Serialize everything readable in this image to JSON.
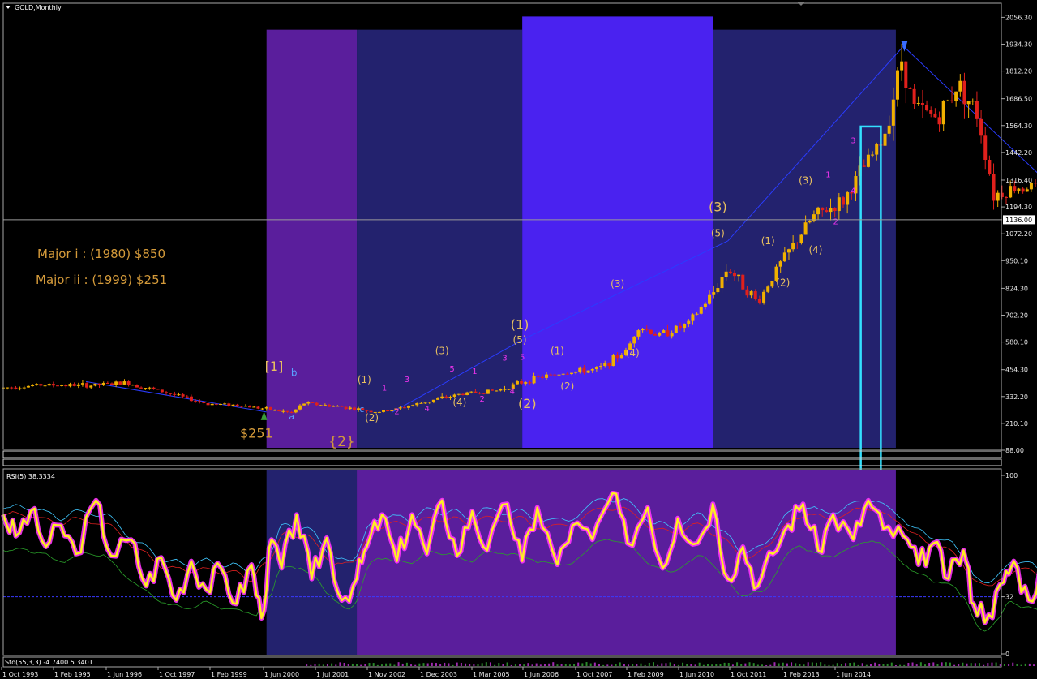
{
  "header": {
    "symbol": "GOLD,Monthly",
    "rsi_label": "RSI(5) 38.3334",
    "sto_label": "Sto(55,3,3) -4.7400 5.3401"
  },
  "notes": {
    "major_i": "Major i : (1980) $850",
    "major_ii": "Major ii : (1999) $251"
  },
  "colors": {
    "background": "#000000",
    "bull_candle": "#f0b000",
    "bear_candle": "#e0201c",
    "shade_violet": "#5a1e9c",
    "shade_navy": "#23226e",
    "shade_blue": "#4a22f0",
    "rsi_main": "#ffee22",
    "rsi_glow": "#ff33ff",
    "box_cyan": "#33e0ff",
    "wave_yellow": "#e8c060",
    "wave_magenta": "#ee33ee",
    "wave_cyan": "#5aa0ff"
  },
  "chart_data": {
    "type": "line",
    "subtype": "candlestick-with-rsi-panel",
    "title": "GOLD,Monthly",
    "price_axis": {
      "ticks": [
        2056.3,
        1934.3,
        1812.2,
        1686.5,
        1564.3,
        1442.2,
        1316.4,
        1194.3,
        1072.2,
        950.1,
        824.3,
        702.2,
        580.1,
        454.3,
        332.2,
        210.1,
        88.0
      ],
      "tick_labels": [
        "2056.30",
        "1934.30",
        "1812.20",
        "1686.50",
        "1564.30",
        "1442.20",
        "1316.40",
        "1194.30",
        "1072.20",
        "950.10",
        "824.30",
        "702.20",
        "580.10",
        "454.30",
        "332.20",
        "210.10",
        "88.00"
      ],
      "current_price": 1136.0,
      "current_label": "1136.00"
    },
    "rsi_axis": {
      "ticks": [
        100,
        32,
        0
      ],
      "tick_labels": [
        "100",
        "32",
        "0"
      ],
      "level_line": 32
    },
    "time_axis": {
      "tick_labels": [
        "1 Oct 1993",
        "1 Feb 1995",
        "1 Jun 1996",
        "1 Oct 1997",
        "1 Feb 1999",
        "1 Jun 2000",
        "1 Jul 2001",
        "1 Nov 2002",
        "1 Dec 2003",
        "1 Mar 2005",
        "1 Jun 2006",
        "1 Oct 2007",
        "1 Feb 2009",
        "1 Jun 2010",
        "1 Oct 2011",
        "1 Feb 2013",
        "1 Jun 2014"
      ]
    },
    "price_path": [
      [
        1993.75,
        372
      ],
      [
        1994.5,
        385
      ],
      [
        1995.5,
        383
      ],
      [
        1996.2,
        395
      ],
      [
        1997.0,
        350
      ],
      [
        1997.8,
        300
      ],
      [
        1998.5,
        292
      ],
      [
        1999.5,
        258
      ],
      [
        1999.75,
        302
      ],
      [
        2000.5,
        285
      ],
      [
        2001.2,
        262
      ],
      [
        2001.5,
        270
      ],
      [
        2002.3,
        315
      ],
      [
        2002.9,
        345
      ],
      [
        2003.6,
        360
      ],
      [
        2004.3,
        412
      ],
      [
        2004.9,
        440
      ],
      [
        2005.6,
        455
      ],
      [
        2006.2,
        545
      ],
      [
        2006.4,
        655
      ],
      [
        2006.8,
        610
      ],
      [
        2007.4,
        660
      ],
      [
        2007.9,
        800
      ],
      [
        2008.2,
        920
      ],
      [
        2008.8,
        760
      ],
      [
        2009.2,
        920
      ],
      [
        2009.9,
        1150
      ],
      [
        2010.5,
        1220
      ],
      [
        2010.9,
        1370
      ],
      [
        2011.3,
        1500
      ],
      [
        2011.67,
        1870
      ],
      [
        2011.9,
        1650
      ],
      [
        2012.4,
        1600
      ],
      [
        2012.8,
        1760
      ],
      [
        2013.2,
        1600
      ],
      [
        2013.5,
        1250
      ],
      [
        2013.9,
        1280
      ],
      [
        2014.3,
        1290
      ],
      [
        2014.7,
        1220
      ],
      [
        2015.2,
        1185
      ],
      [
        2015.6,
        1100
      ]
    ],
    "wave_lines": [
      [
        [
          1995.4,
          400
        ],
        [
          1999.0,
          262
        ]
      ],
      [
        [
          2001.5,
          260
        ],
        [
          2004.1,
          590
        ]
      ],
      [
        [
          2004.1,
          590
        ],
        [
          2008.2,
          1040
        ]
      ],
      [
        [
          2008.2,
          1040
        ],
        [
          2011.7,
          1925
        ]
      ],
      [
        [
          2011.7,
          1925
        ],
        [
          2015.6,
          1085
        ]
      ]
    ],
    "shaded_regions": [
      {
        "from": 1999.0,
        "to": 2000.8,
        "color": "violet",
        "price_top": 2000
      },
      {
        "from": 2000.8,
        "to": 2004.1,
        "color": "navy",
        "price_top": 2000
      },
      {
        "from": 2004.1,
        "to": 2007.9,
        "color": "blue",
        "price_top": 2060
      },
      {
        "from": 2007.9,
        "to": 2011.55,
        "color": "navy",
        "price_top": 2000
      }
    ],
    "rsi_shaded_regions": [
      {
        "from": 1999.0,
        "to": 2000.8,
        "color": "navy"
      },
      {
        "from": 2000.8,
        "to": 2011.55,
        "color": "violet"
      }
    ],
    "highlight_box": {
      "from": 2010.85,
      "to": 2011.25,
      "price_top": 1560
    },
    "wave_labels": [
      {
        "t": "[1]",
        "x": 1999.15,
        "p": 450,
        "c": "yellow",
        "s": 16
      },
      {
        "t": "b",
        "x": 1999.55,
        "p": 425,
        "c": "cyan",
        "s": 12
      },
      {
        "t": "a",
        "x": 1999.5,
        "p": 228,
        "c": "cyan",
        "s": 11
      },
      {
        "t": "$251",
        "x": 1998.8,
        "p": 145,
        "c": "orange",
        "s": 16
      },
      {
        "t": "c",
        "x": 2000.9,
        "p": 262,
        "c": "cyan",
        "s": 11
      },
      {
        "t": "{2}",
        "x": 2000.5,
        "p": 107,
        "c": "orange",
        "s": 17
      },
      {
        "t": "(1)",
        "x": 2000.95,
        "p": 395,
        "c": "yellow",
        "s": 12
      },
      {
        "t": "1",
        "x": 2001.35,
        "p": 360,
        "c": "magenta",
        "s": 10
      },
      {
        "t": "3",
        "x": 2001.8,
        "p": 397,
        "c": "magenta",
        "s": 10
      },
      {
        "t": "2",
        "x": 2001.6,
        "p": 252,
        "c": "magenta",
        "s": 10
      },
      {
        "t": "(2)",
        "x": 2001.1,
        "p": 220,
        "c": "yellow",
        "s": 12
      },
      {
        "t": "4",
        "x": 2002.2,
        "p": 265,
        "c": "magenta",
        "s": 10
      },
      {
        "t": "(3)",
        "x": 2002.5,
        "p": 525,
        "c": "yellow",
        "s": 12
      },
      {
        "t": "5",
        "x": 2002.7,
        "p": 445,
        "c": "magenta",
        "s": 10
      },
      {
        "t": "1",
        "x": 2003.15,
        "p": 435,
        "c": "magenta",
        "s": 10
      },
      {
        "t": "(4)",
        "x": 2002.85,
        "p": 290,
        "c": "yellow",
        "s": 12
      },
      {
        "t": "2",
        "x": 2003.3,
        "p": 310,
        "c": "magenta",
        "s": 10
      },
      {
        "t": "3",
        "x": 2003.75,
        "p": 495,
        "c": "magenta",
        "s": 10
      },
      {
        "t": "5",
        "x": 2004.1,
        "p": 500,
        "c": "magenta",
        "s": 10
      },
      {
        "t": "4",
        "x": 2003.9,
        "p": 345,
        "c": "magenta",
        "s": 10
      },
      {
        "t": "(1)",
        "x": 2004.05,
        "p": 640,
        "c": "yellow",
        "s": 16
      },
      {
        "t": "(5)",
        "x": 2004.05,
        "p": 575,
        "c": "yellow",
        "s": 12
      },
      {
        "t": "(2)",
        "x": 2004.2,
        "p": 280,
        "c": "yellow",
        "s": 16
      },
      {
        "t": "(1)",
        "x": 2004.8,
        "p": 525,
        "c": "yellow",
        "s": 12
      },
      {
        "t": "(2)",
        "x": 2005.0,
        "p": 365,
        "c": "yellow",
        "s": 12
      },
      {
        "t": "(3)",
        "x": 2006.0,
        "p": 830,
        "c": "yellow",
        "s": 12
      },
      {
        "t": "(4)",
        "x": 2006.3,
        "p": 515,
        "c": "yellow",
        "s": 12
      },
      {
        "t": "(3)",
        "x": 2008.0,
        "p": 1175,
        "c": "yellow",
        "s": 16
      },
      {
        "t": "(5)",
        "x": 2008.0,
        "p": 1060,
        "c": "yellow",
        "s": 12
      },
      {
        "t": "(1)",
        "x": 2009.0,
        "p": 1025,
        "c": "yellow",
        "s": 12
      },
      {
        "t": "(2)",
        "x": 2009.3,
        "p": 835,
        "c": "yellow",
        "s": 12
      },
      {
        "t": "(3)",
        "x": 2009.75,
        "p": 1300,
        "c": "yellow",
        "s": 12
      },
      {
        "t": "1",
        "x": 2010.2,
        "p": 1330,
        "c": "magenta",
        "s": 10
      },
      {
        "t": "2",
        "x": 2010.35,
        "p": 1115,
        "c": "magenta",
        "s": 10
      },
      {
        "t": "(4)",
        "x": 2009.95,
        "p": 985,
        "c": "yellow",
        "s": 12
      },
      {
        "t": "3",
        "x": 2010.7,
        "p": 1485,
        "c": "magenta",
        "s": 10
      },
      {
        "t": "4",
        "x": 2010.7,
        "p": 1255,
        "c": "magenta",
        "s": 10
      }
    ],
    "rsi_series": [
      {
        "name": "RSI(5)",
        "values": [
          [
            1993.75,
            78
          ],
          [
            1994.0,
            66
          ],
          [
            1994.3,
            80
          ],
          [
            1994.6,
            60
          ],
          [
            1994.9,
            72
          ],
          [
            1995.2,
            56
          ],
          [
            1995.6,
            86
          ],
          [
            1995.9,
            55
          ],
          [
            1996.3,
            64
          ],
          [
            1996.6,
            38
          ],
          [
            1996.9,
            54
          ],
          [
            1997.2,
            30
          ],
          [
            1997.5,
            52
          ],
          [
            1997.8,
            36
          ],
          [
            1998.1,
            48
          ],
          [
            1998.4,
            28
          ],
          [
            1998.7,
            50
          ],
          [
            1998.9,
            20
          ],
          [
            1999.1,
            64
          ],
          [
            1999.3,
            48
          ],
          [
            1999.6,
            78
          ],
          [
            1999.9,
            42
          ],
          [
            2000.2,
            65
          ],
          [
            2000.5,
            30
          ],
          [
            2000.8,
            42
          ],
          [
            2001.0,
            60
          ],
          [
            2001.3,
            78
          ],
          [
            2001.6,
            52
          ],
          [
            2001.9,
            78
          ],
          [
            2002.2,
            56
          ],
          [
            2002.5,
            86
          ],
          [
            2002.8,
            55
          ],
          [
            2003.1,
            80
          ],
          [
            2003.4,
            58
          ],
          [
            2003.8,
            84
          ],
          [
            2004.1,
            52
          ],
          [
            2004.4,
            82
          ],
          [
            2004.8,
            50
          ],
          [
            2005.1,
            72
          ],
          [
            2005.5,
            64
          ],
          [
            2005.9,
            90
          ],
          [
            2006.2,
            62
          ],
          [
            2006.6,
            82
          ],
          [
            2006.9,
            48
          ],
          [
            2007.2,
            76
          ],
          [
            2007.6,
            62
          ],
          [
            2007.9,
            84
          ],
          [
            2008.2,
            42
          ],
          [
            2008.5,
            60
          ],
          [
            2008.8,
            38
          ],
          [
            2009.1,
            56
          ],
          [
            2009.4,
            72
          ],
          [
            2009.7,
            84
          ],
          [
            2010.0,
            58
          ],
          [
            2010.3,
            78
          ],
          [
            2010.7,
            64
          ],
          [
            2011.0,
            86
          ],
          [
            2011.3,
            70
          ],
          [
            2011.7,
            66
          ],
          [
            2012.0,
            50
          ],
          [
            2012.3,
            62
          ],
          [
            2012.6,
            42
          ],
          [
            2012.9,
            58
          ],
          [
            2013.1,
            28
          ],
          [
            2013.4,
            22
          ],
          [
            2013.7,
            40
          ],
          [
            2013.9,
            52
          ],
          [
            2014.2,
            30
          ],
          [
            2014.5,
            50
          ],
          [
            2014.8,
            24
          ],
          [
            2015.0,
            62
          ],
          [
            2015.3,
            30
          ],
          [
            2015.6,
            38
          ]
        ]
      }
    ]
  }
}
